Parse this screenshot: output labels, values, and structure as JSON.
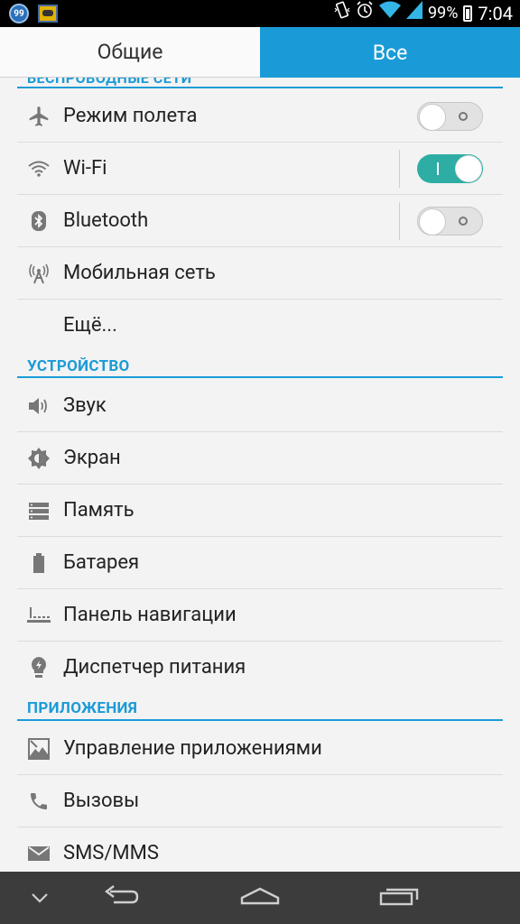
{
  "status_bar": {
    "notification_badge": "99",
    "battery_percent": "99%",
    "time": "7:04"
  },
  "tabs": [
    {
      "label": "Общие",
      "selected": false
    },
    {
      "label": "Все",
      "selected": true
    }
  ],
  "sections": {
    "wireless": {
      "header": "БЕСПРОВОДНЫЕ СЕТИ"
    },
    "device": {
      "header": "УСТРОЙСТВО"
    },
    "apps": {
      "header": "ПРИЛОЖЕНИЯ"
    }
  },
  "items": {
    "airplane": {
      "label": "Режим полета",
      "icon": "airplane-icon",
      "toggle": "off"
    },
    "wifi": {
      "label": "Wi-Fi",
      "icon": "wifi-icon",
      "toggle": "on"
    },
    "bluetooth": {
      "label": "Bluetooth",
      "icon": "bluetooth-icon",
      "toggle": "off"
    },
    "mobile": {
      "label": "Мобильная сеть",
      "icon": "cell-tower-icon"
    },
    "more": {
      "label": "Ещё..."
    },
    "sound": {
      "label": "Звук",
      "icon": "speaker-icon"
    },
    "display": {
      "label": "Экран",
      "icon": "brightness-icon"
    },
    "storage": {
      "label": "Память",
      "icon": "storage-icon"
    },
    "battery": {
      "label": "Батарея",
      "icon": "battery-icon"
    },
    "navbar": {
      "label": "Панель навигации",
      "icon": "navigation-bar-icon"
    },
    "power": {
      "label": "Диспетчер питания",
      "icon": "lightbulb-icon"
    },
    "apps_manage": {
      "label": "Управление приложениями",
      "icon": "apps-icon"
    },
    "calls": {
      "label": "Вызовы",
      "icon": "phone-icon"
    },
    "sms": {
      "label": "SMS/MMS",
      "icon": "mail-icon"
    }
  },
  "colors": {
    "accent": "#1a9bd7",
    "toggle_on": "#2dada4",
    "navbar": "#3c3c3c"
  }
}
